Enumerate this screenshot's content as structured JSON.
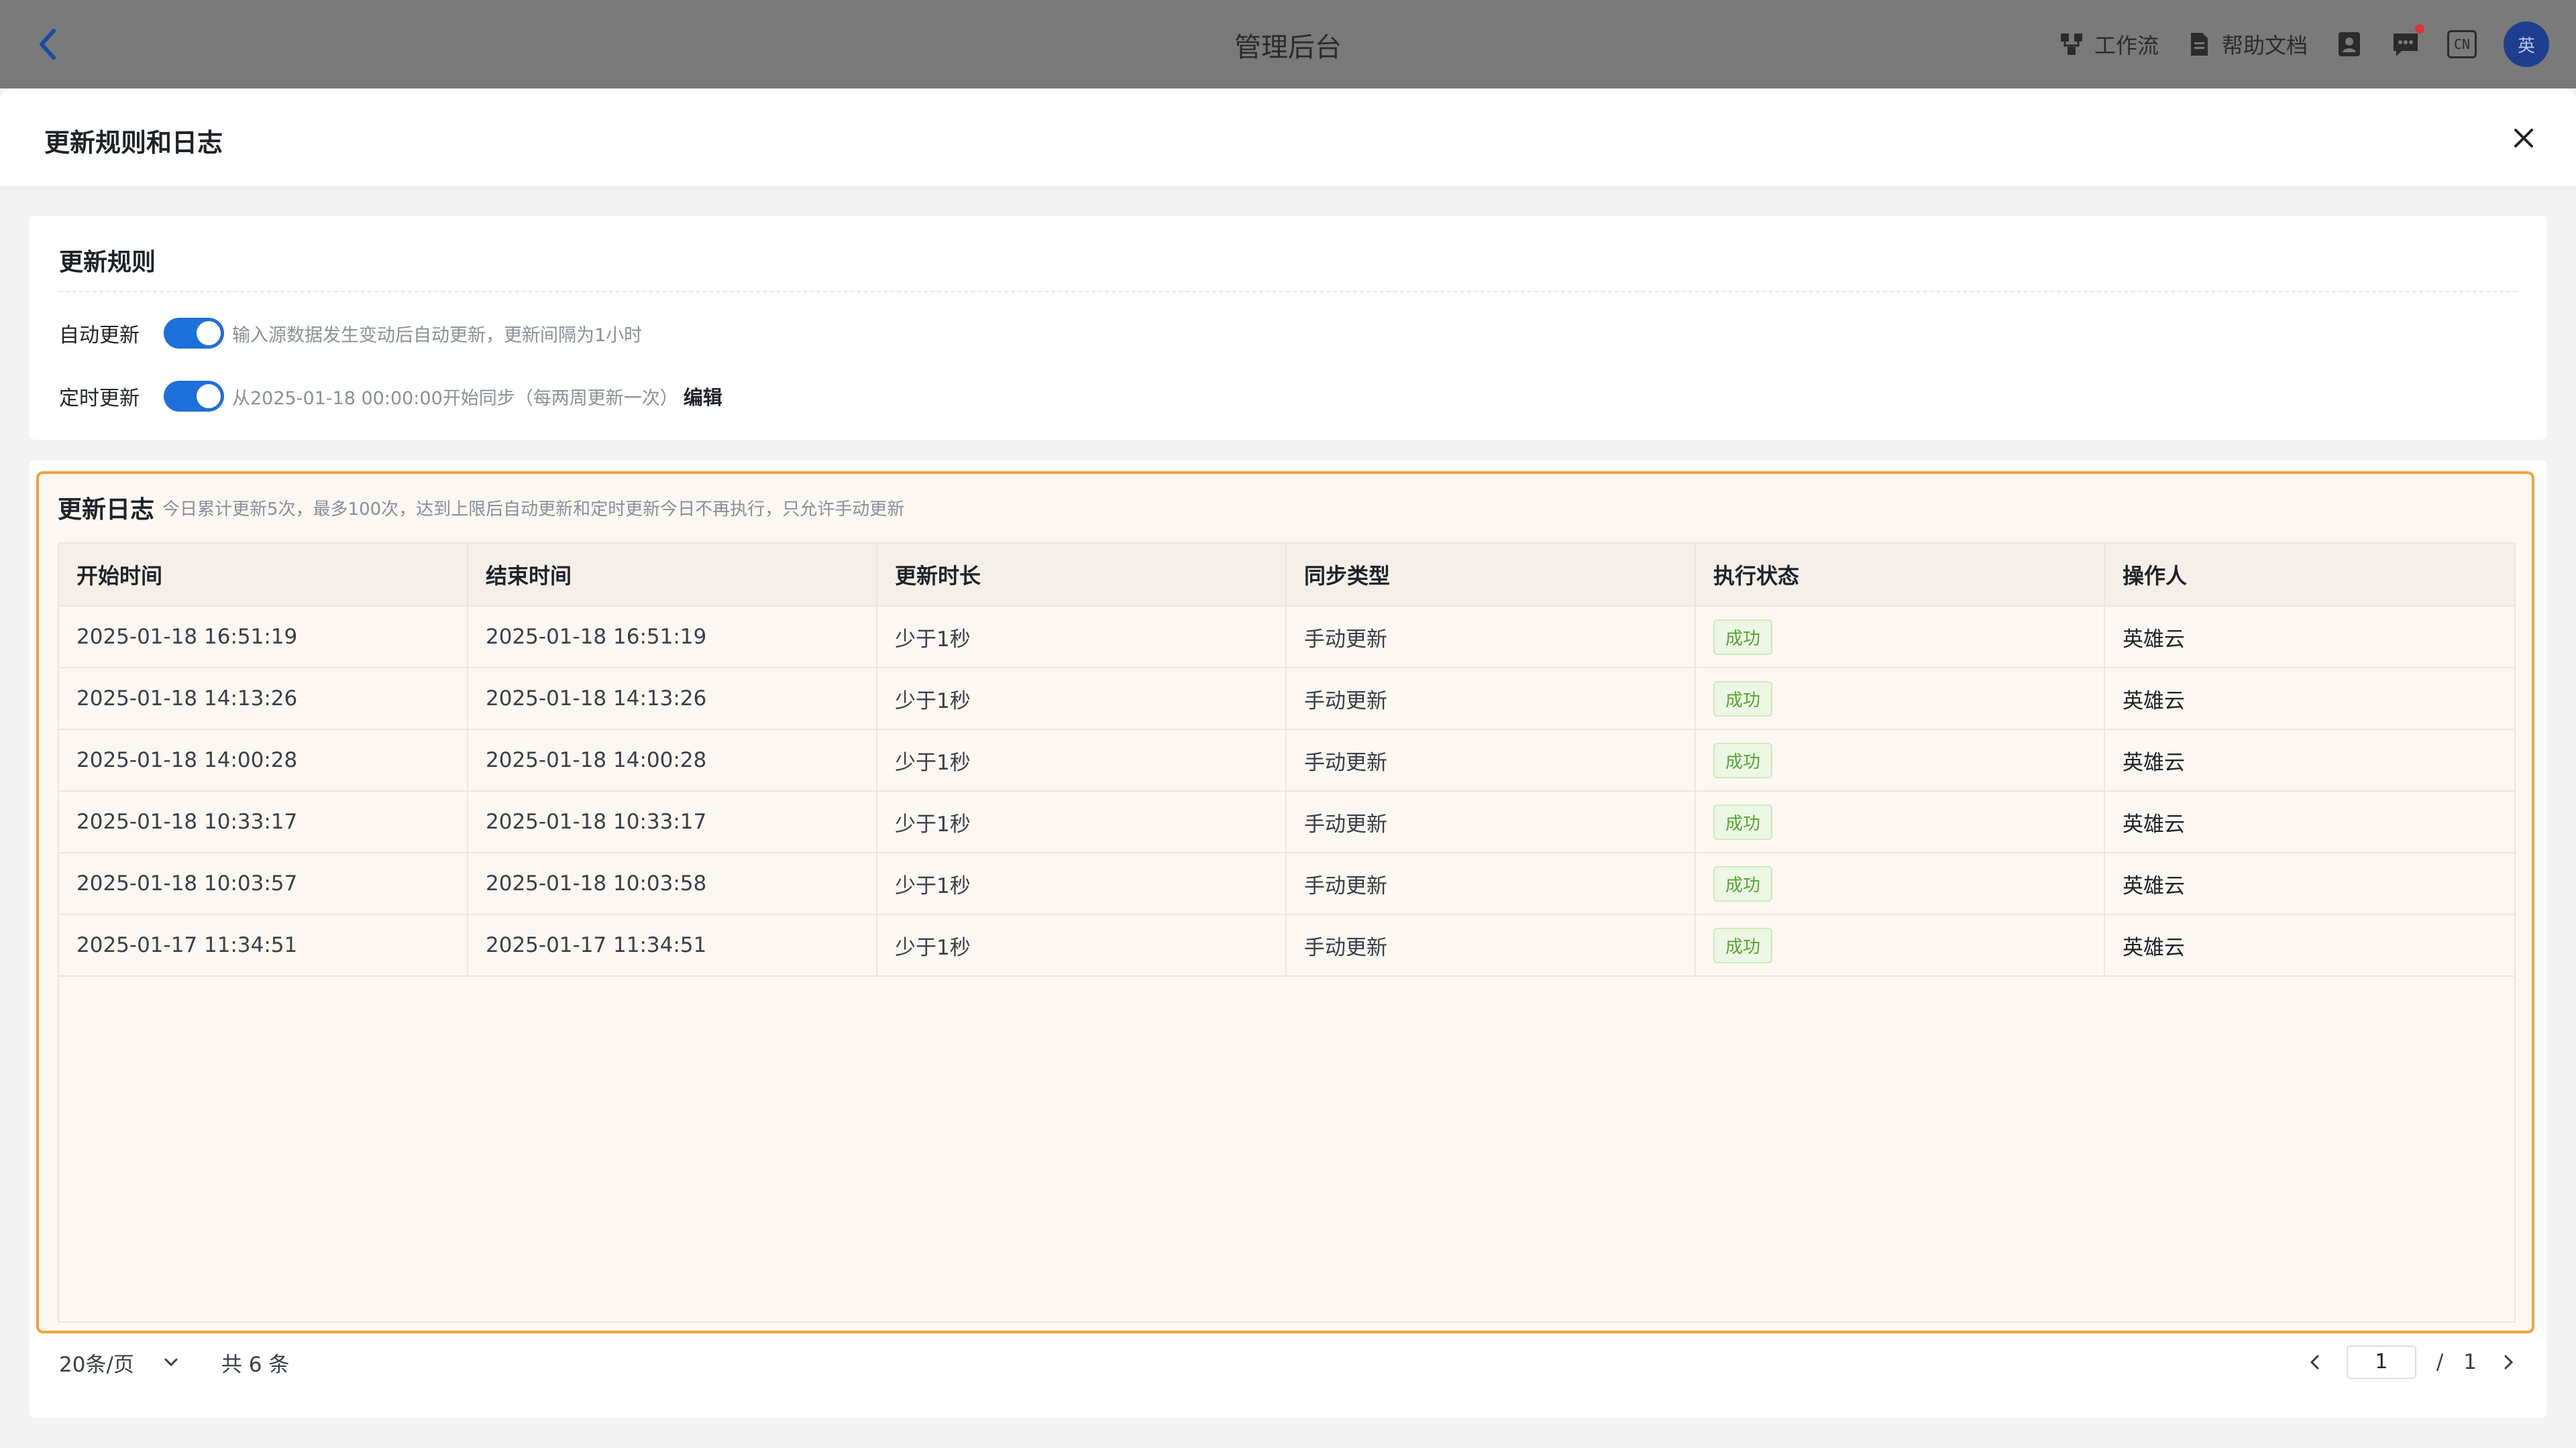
{
  "app": {
    "title": "管理后台",
    "actions": [
      {
        "label": "工作流",
        "icon": "workflow-icon"
      },
      {
        "label": "帮助文档",
        "icon": "document-icon"
      }
    ],
    "language_badge": "CN",
    "avatar_text": "英"
  },
  "drawer": {
    "title": "更新规则和日志"
  },
  "rules": {
    "title": "更新规则",
    "auto_update": {
      "label": "自动更新",
      "enabled": true,
      "description": "输入源数据发生变动后自动更新，更新间隔为1小时"
    },
    "scheduled_update": {
      "label": "定时更新",
      "enabled": true,
      "description": "从2025-01-18 00:00:00开始同步（每两周更新一次）",
      "edit_label": "编辑"
    }
  },
  "log": {
    "title": "更新日志",
    "note": "今日累计更新5次，最多100次，达到上限后自动更新和定时更新今日不再执行，只允许手动更新",
    "columns": [
      "开始时间",
      "结束时间",
      "更新时长",
      "同步类型",
      "执行状态",
      "操作人"
    ],
    "rows": [
      [
        "2025-01-18 16:51:19",
        "2025-01-18 16:51:19",
        "少于1秒",
        "手动更新",
        "成功",
        "英雄云"
      ],
      [
        "2025-01-18 14:13:26",
        "2025-01-18 14:13:26",
        "少于1秒",
        "手动更新",
        "成功",
        "英雄云"
      ],
      [
        "2025-01-18 14:00:28",
        "2025-01-18 14:00:28",
        "少于1秒",
        "手动更新",
        "成功",
        "英雄云"
      ],
      [
        "2025-01-18 10:33:17",
        "2025-01-18 10:33:17",
        "少于1秒",
        "手动更新",
        "成功",
        "英雄云"
      ],
      [
        "2025-01-18 10:03:57",
        "2025-01-18 10:03:58",
        "少于1秒",
        "手动更新",
        "成功",
        "英雄云"
      ],
      [
        "2025-01-17 11:34:51",
        "2025-01-17 11:34:51",
        "少于1秒",
        "手动更新",
        "成功",
        "英雄云"
      ]
    ]
  },
  "pagination": {
    "page_size": "20条/页",
    "total": "共 6 条",
    "current_page": "1",
    "separator": "/",
    "total_pages": "1"
  },
  "colors": {
    "accent": "#1e6fd9",
    "highlight_border": "#f0a33d",
    "success": "#55a532"
  }
}
